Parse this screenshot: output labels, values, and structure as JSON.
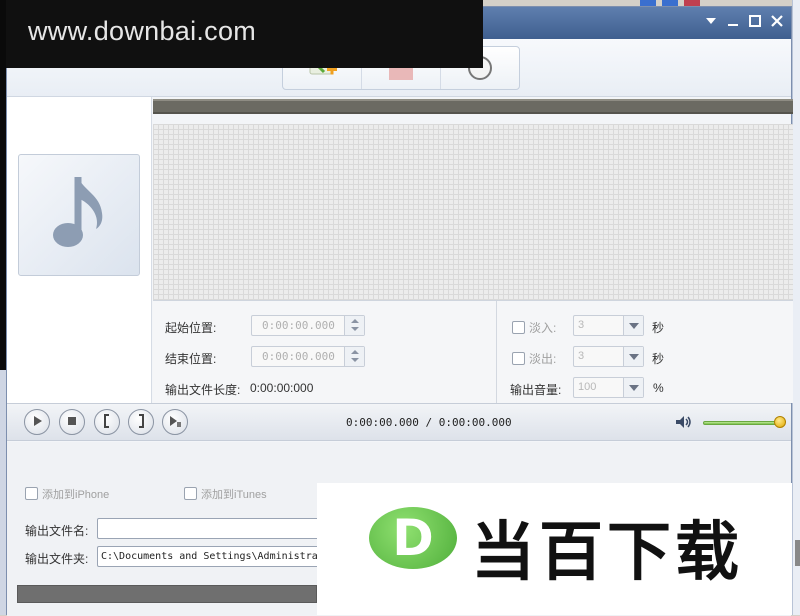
{
  "watermark": {
    "site": "www.downbai.com",
    "logo_letter": "D",
    "logo_brand": "当百下载"
  },
  "window": {
    "controls": [
      "dropdown",
      "minimize",
      "maximize",
      "close"
    ]
  },
  "toolbar": {
    "buttons": [
      "add-file-icon",
      "remove-icon",
      "convert-icon"
    ]
  },
  "settings": {
    "start_label": "起始位置:",
    "start_value": "0:00:00.000",
    "end_label": "结束位置:",
    "end_value": "0:00:00.000",
    "length_label": "输出文件长度:",
    "length_value": "0:00:00:000",
    "fade_in_label": "淡入:",
    "fade_in_value": "3",
    "fade_in_unit": "秒",
    "fade_out_label": "淡出:",
    "fade_out_value": "3",
    "fade_out_unit": "秒",
    "volume_label": "输出音量:",
    "volume_value": "100",
    "volume_unit": "%"
  },
  "playback": {
    "timecode": "0:00:00.000 / 0:00:00.000",
    "volume_level": 1.0
  },
  "output": {
    "iphone_label": "添加到iPhone",
    "itunes_label": "添加到iTunes",
    "filename_label": "输出文件名:",
    "filename_value": "",
    "folder_label": "输出文件夹:",
    "folder_value": "C:\\Documents and Settings\\Administrat"
  },
  "colors": {
    "titlebar": "#4f6f9f",
    "volume_fill": "#79c04a",
    "logo_green": "#5cb840"
  }
}
